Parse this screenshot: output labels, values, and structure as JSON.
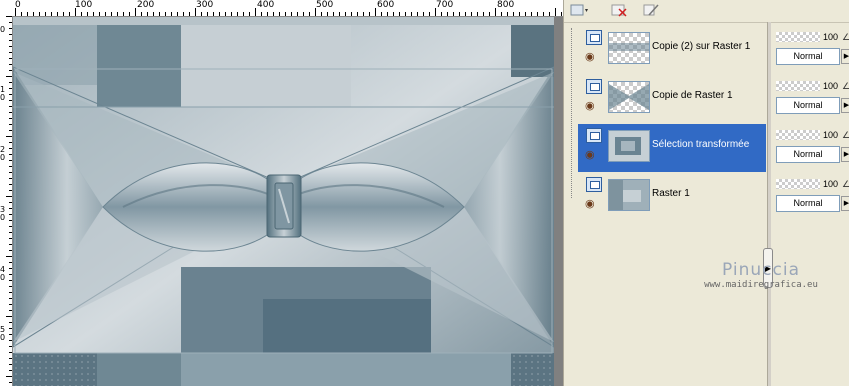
{
  "ruler": {
    "h_labels": [
      "0",
      "100",
      "200",
      "300",
      "400",
      "500",
      "600",
      "700",
      "800"
    ],
    "v_labels": [
      "0",
      "1 0",
      "2 0",
      "3 0",
      "4 0",
      "5 0"
    ]
  },
  "layers": [
    {
      "name": "Copie (2) sur Raster 1",
      "selected": false
    },
    {
      "name": "Copie de Raster 1",
      "selected": false
    },
    {
      "name": "Sélection transformée",
      "selected": true
    },
    {
      "name": "Raster 1",
      "selected": false
    }
  ],
  "layer_props": [
    {
      "opacity": "100",
      "blend": "Normal"
    },
    {
      "opacity": "100",
      "blend": "Normal"
    },
    {
      "opacity": "100",
      "blend": "Normal"
    },
    {
      "opacity": "100",
      "blend": "Normal"
    }
  ],
  "watermark": {
    "name": "Pinuccia",
    "url": "www.maidiregrafica.eu"
  },
  "colors": {
    "selection": "#316ac5",
    "canvas_dark": "#5b7482",
    "canvas_light": "#d6dde1"
  },
  "icons": {
    "layer_type": "raster-layer-icon",
    "visibility": "eye-icon",
    "lock": "lock-icon"
  }
}
